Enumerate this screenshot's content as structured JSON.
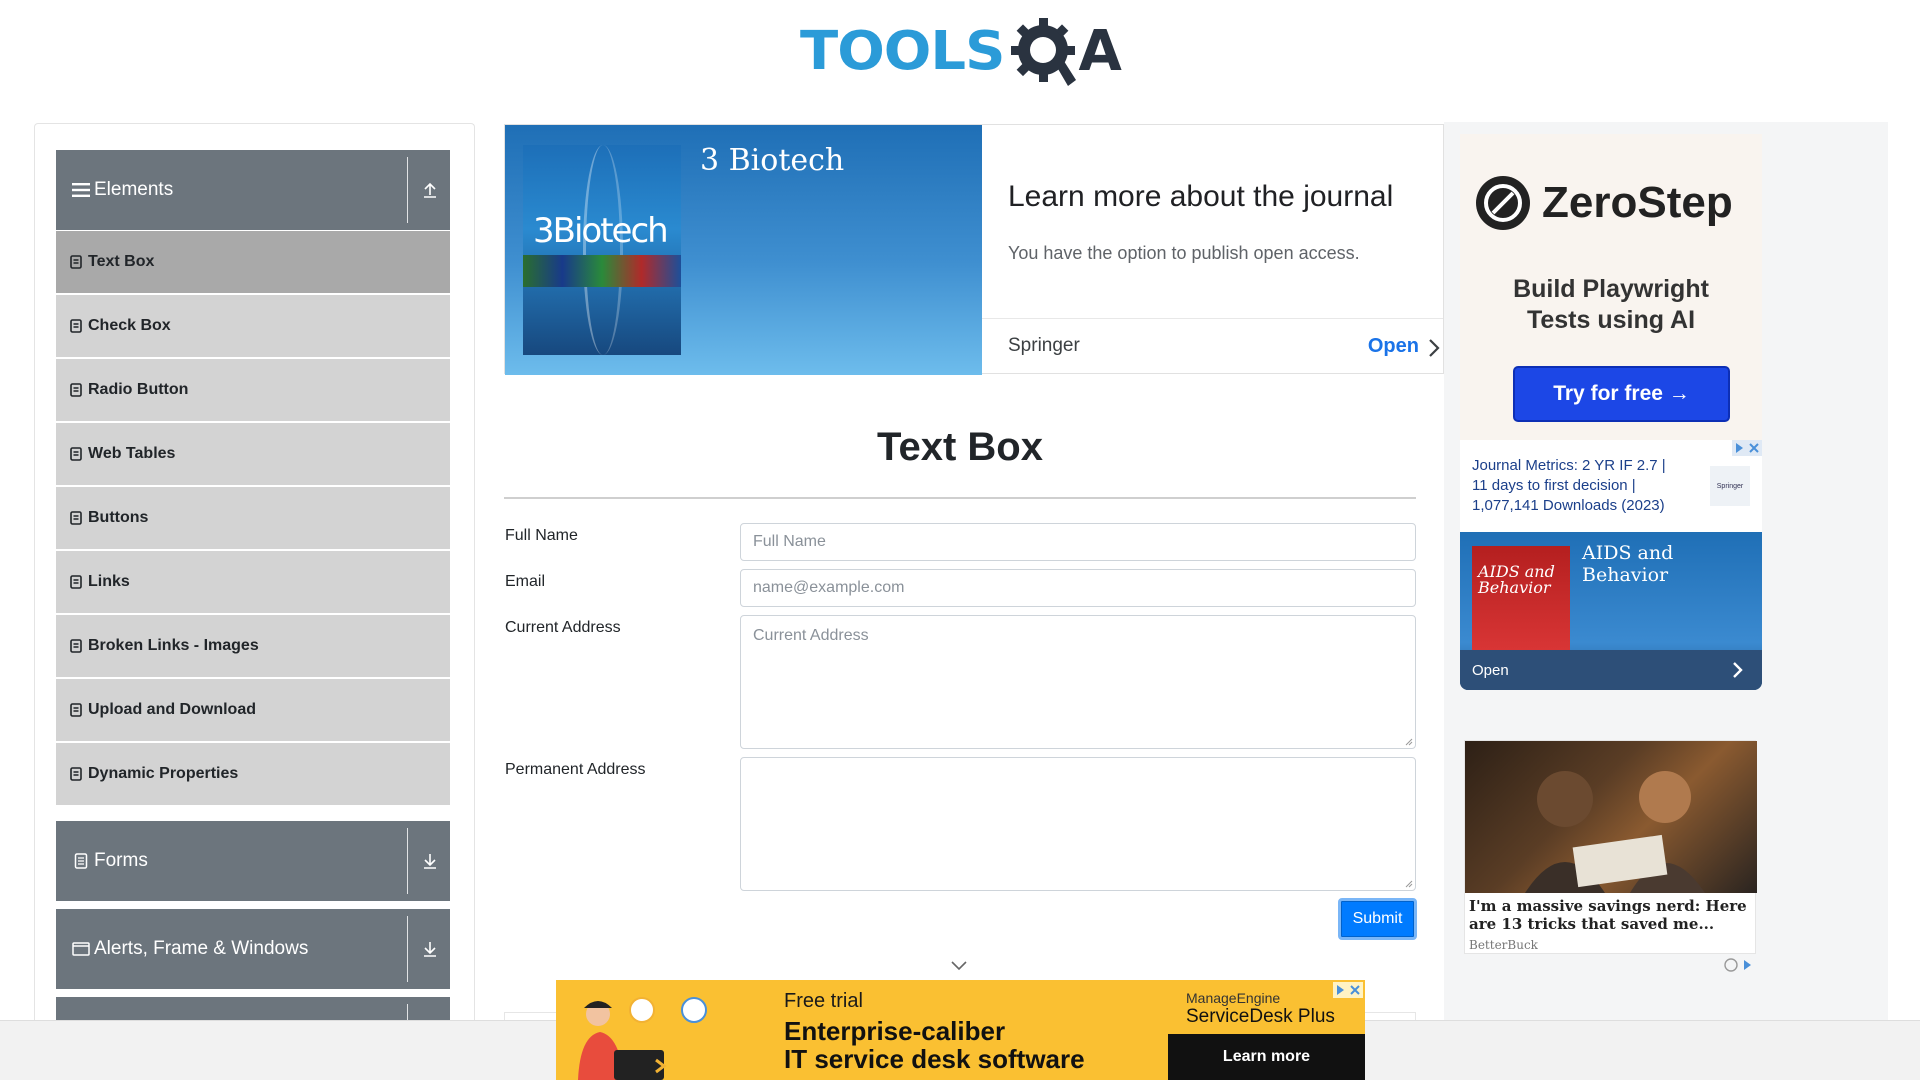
{
  "logo": {
    "tools": "TOOLS",
    "a": "A"
  },
  "sidebar": {
    "groups": [
      {
        "title": "Elements",
        "icon": "hamburger-icon",
        "arrow": "upload-arrow-icon"
      },
      {
        "title": "Forms",
        "icon": "document-icon",
        "arrow": "download-arrow-icon"
      },
      {
        "title": "Alerts, Frame & Windows",
        "icon": "window-icon",
        "arrow": "download-arrow-icon"
      }
    ],
    "items": [
      {
        "label": "Text Box",
        "active": true
      },
      {
        "label": "Check Box"
      },
      {
        "label": "Radio Button"
      },
      {
        "label": "Web Tables"
      },
      {
        "label": "Buttons"
      },
      {
        "label": "Links"
      },
      {
        "label": "Broken Links - Images"
      },
      {
        "label": "Upload and Download"
      },
      {
        "label": "Dynamic Properties"
      }
    ]
  },
  "top_ad": {
    "journal": "3 Biotech",
    "cover_title": "3Biotech",
    "headline": "Learn more about the journal",
    "sub": "You have the option to publish open access.",
    "brand": "Springer",
    "open": "Open"
  },
  "form": {
    "title": "Text Box",
    "full_name_label": "Full Name",
    "full_name_placeholder": "Full Name",
    "email_label": "Email",
    "email_placeholder": "name@example.com",
    "current_address_label": "Current Address",
    "current_address_placeholder": "Current Address",
    "permanent_address_label": "Permanent Address",
    "submit": "Submit"
  },
  "right_ads": {
    "zerostep": {
      "name": "ZeroStep",
      "tagline_1": "Build Playwright",
      "tagline_2": "Tests using AI",
      "button": "Try for free →"
    },
    "springer": {
      "metrics_1": "Journal Metrics: 2 YR IF 2.7 |",
      "metrics_2": "11 days to first decision |",
      "metrics_3": "1,077,141 Downloads (2023)",
      "logo": "Springer",
      "journal": "AIDS and Behavior",
      "cover_1": "AIDS and",
      "cover_2": "Behavior",
      "open": "Open"
    },
    "news": {
      "headline": "I'm a massive savings nerd: Here are 13 tricks that saved me...",
      "source": "BetterBuck"
    }
  },
  "bottom_ad": {
    "small": "Free trial",
    "line1": "Enterprise-caliber",
    "line2": "IT service desk software",
    "brand_top": "ManageEngine",
    "brand": "ServiceDesk Plus",
    "button": "Learn more"
  },
  "colors": {
    "logo_blue": "#2b9bd8",
    "logo_dark": "#2a3340",
    "sidebar_header": "#6c757d",
    "menu_item": "#d3d3d3",
    "menu_item_active": "#a9a9a9",
    "submit": "#007bff",
    "zerostep_button": "#1c47e6",
    "bottom_ad_bg": "#fac032"
  }
}
